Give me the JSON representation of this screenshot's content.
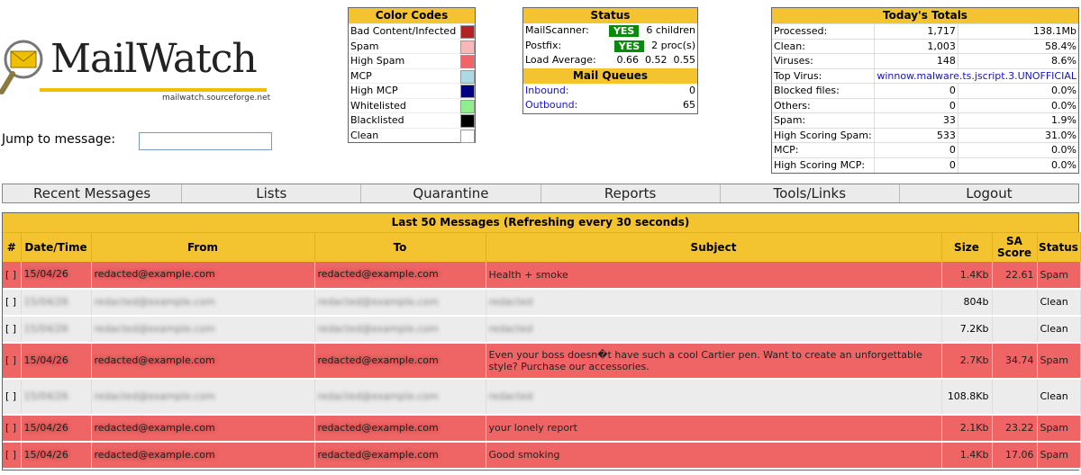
{
  "logo": {
    "word": "MailWatch",
    "url": "mailwatch.sourceforge.net"
  },
  "jump": {
    "label": "Jump to message:",
    "value": ""
  },
  "colors": {
    "title": "Color Codes",
    "items": [
      {
        "label": "Bad Content/Infected",
        "color": "#b22222"
      },
      {
        "label": "Spam",
        "color": "#f8b8b8"
      },
      {
        "label": "High Spam",
        "color": "#ef6464"
      },
      {
        "label": "MCP",
        "color": "#add8e6"
      },
      {
        "label": "High MCP",
        "color": "#000080"
      },
      {
        "label": "Whitelisted",
        "color": "#90ee90"
      },
      {
        "label": "Blacklisted",
        "color": "#000000"
      },
      {
        "label": "Clean",
        "color": "#ffffff"
      }
    ]
  },
  "status": {
    "title": "Status",
    "mailscanner": {
      "label": "MailScanner:",
      "state": "YES",
      "info": "6 children"
    },
    "postfix": {
      "label": "Postfix:",
      "state": "YES",
      "info": "2 proc(s)"
    },
    "load": {
      "label": "Load Average:",
      "values": "0.66  0.52  0.55"
    },
    "queues_title": "Mail Queues",
    "inbound": {
      "label": "Inbound:",
      "value": "0"
    },
    "outbound": {
      "label": "Outbound:",
      "value": "65"
    }
  },
  "totals": {
    "title": "Today's Totals",
    "rows": [
      {
        "label": "Processed:",
        "count": "1,717",
        "value": "138.1Mb"
      },
      {
        "label": "Clean:",
        "count": "1,003",
        "value": "58.4%"
      },
      {
        "label": "Viruses:",
        "count": "148",
        "value": "8.6%"
      },
      {
        "label": "Top Virus:",
        "count": "",
        "value": "winnow.malware.ts.jscript.3.UNOFFICIAL"
      },
      {
        "label": "Blocked files:",
        "count": "0",
        "value": "0.0%"
      },
      {
        "label": "Others:",
        "count": "0",
        "value": "0.0%"
      },
      {
        "label": "Spam:",
        "count": "33",
        "value": "1.9%"
      },
      {
        "label": "High Scoring Spam:",
        "count": "533",
        "value": "31.0%"
      },
      {
        "label": "MCP:",
        "count": "0",
        "value": "0.0%"
      },
      {
        "label": "High Scoring MCP:",
        "count": "0",
        "value": "0.0%"
      }
    ]
  },
  "menu": [
    "Recent Messages",
    "Lists",
    "Quarantine",
    "Reports",
    "Tools/Links",
    "Logout"
  ],
  "messages": {
    "title": "Last 50 Messages (Refreshing every 30 seconds)",
    "headers": {
      "num": "#",
      "date": "Date/Time",
      "from": "From",
      "to": "To",
      "subject": "Subject",
      "size": "Size",
      "score_1": "SA",
      "score_2": "Score",
      "status": "Status"
    },
    "rows": [
      {
        "mark": "[ ]",
        "date": "15/04/26",
        "from": "redacted@example.com",
        "to": "redacted@example.com",
        "subject": "Health + smoke",
        "size": "1.4Kb",
        "score": "22.61",
        "status": "Spam",
        "kind": "spam"
      },
      {
        "mark": "[ ]",
        "date": "15/04/26",
        "from": "redacted@example.com",
        "to": "redacted@example.com",
        "subject": "redacted",
        "size": "804b",
        "score": "",
        "status": "Clean",
        "kind": "clean"
      },
      {
        "mark": "[ ]",
        "date": "15/04/26",
        "from": "redacted@example.com",
        "to": "redacted@example.com",
        "subject": "redacted",
        "size": "7.2Kb",
        "score": "",
        "status": "Clean",
        "kind": "clean"
      },
      {
        "mark": "[ ]",
        "date": "15/04/26",
        "from": "redacted@example.com",
        "to": "redacted@example.com",
        "subject": "Even your boss doesn�t have such a cool Cartier pen. Want to create an unforgettable style? Purchase our accessories.",
        "size": "2.7Kb",
        "score": "34.74",
        "status": "Spam",
        "kind": "spam"
      },
      {
        "mark": "[ ]",
        "date": "15/04/26",
        "from": "redacted@example.com",
        "to": "redacted@example.com",
        "subject": "redacted",
        "size": "108.8Kb",
        "score": "",
        "status": "Clean",
        "kind": "clean"
      },
      {
        "mark": "[ ]",
        "date": "15/04/26",
        "from": "redacted@example.com",
        "to": "redacted@example.com",
        "subject": "your lonely report",
        "size": "2.1Kb",
        "score": "23.22",
        "status": "Spam",
        "kind": "spam"
      },
      {
        "mark": "[ ]",
        "date": "15/04/26",
        "from": "redacted@example.com",
        "to": "redacted@example.com",
        "subject": "Good smoking",
        "size": "1.4Kb",
        "score": "17.06",
        "status": "Spam",
        "kind": "spam"
      }
    ]
  }
}
